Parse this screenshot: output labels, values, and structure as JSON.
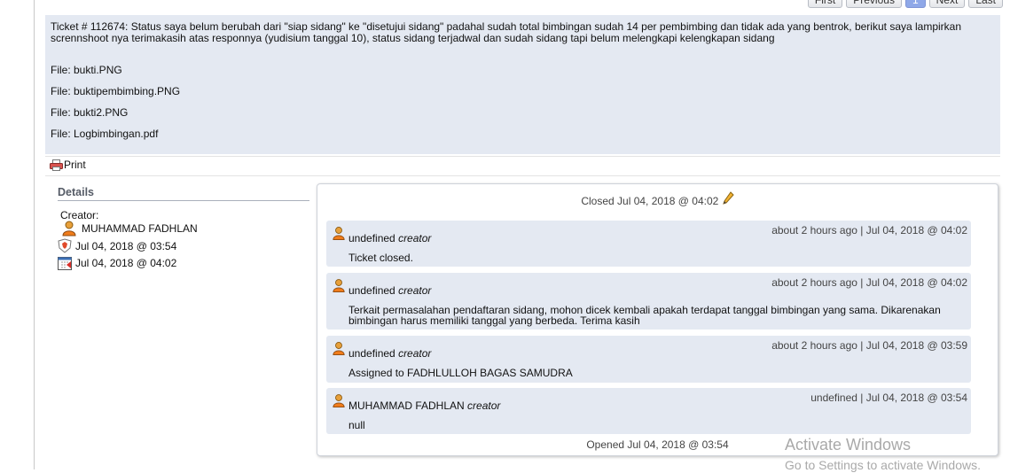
{
  "pagination": {
    "first": "First",
    "previous": "Previous",
    "current": "1",
    "next": "Next",
    "last": "Last"
  },
  "ticket": {
    "description": "Ticket # 112674: Status saya belum berubah dari \"siap sidang\" ke \"disetujui sidang\" padahal sudah total bimbingan sudah 14 per pembimbing dan tidak ada yang bentrok, berikut saya lampirkan scrennshoot nya terimakasih atas responnya (yudisium tanggal 10), status sidang terjadwal dan sudah sidang tapi belum melengkapi kelengkapan sidang",
    "files": [
      "File: bukti.PNG",
      "File: buktipembimbing.PNG",
      "File: bukti2.PNG",
      "File: Logbimbingan.pdf"
    ]
  },
  "print_label": "Print",
  "details": {
    "heading": "Details",
    "creator_label": "Creator:",
    "creator_name": "MUHAMMAD FADHLAN",
    "created_at": "Jul 04, 2018 @ 03:54",
    "closed_at": "Jul 04, 2018 @ 04:02"
  },
  "timeline": {
    "closed_text": "Closed Jul 04, 2018 @ 04:02",
    "opened_text": "Opened Jul 04, 2018 @ 03:54",
    "notes": [
      {
        "author": "undefined",
        "role": "creator",
        "when": "about 2 hours ago | Jul 04, 2018 @ 04:02",
        "text": "Ticket closed."
      },
      {
        "author": "undefined",
        "role": "creator",
        "when": "about 2 hours ago | Jul 04, 2018 @ 04:02",
        "text": "Terkait permasalahan pendaftaran sidang, mohon dicek kembali apakah terdapat tanggal bimbingan yang sama. Dikarenakan bimbingan harus memiliki tanggal yang berbeda. Terima kasih"
      },
      {
        "author": "undefined",
        "role": "creator",
        "when": "about 2 hours ago | Jul 04, 2018 @ 03:59",
        "text": "Assigned to FADHLULLOH BAGAS SAMUDRA"
      },
      {
        "author": "MUHAMMAD FADHLAN",
        "role": "creator",
        "when": "undefined | Jul 04, 2018 @ 03:54",
        "text": "null"
      }
    ]
  },
  "watermark": {
    "line1": "Activate Windows",
    "line2": "Go to Settings to activate Windows."
  },
  "icons": {
    "print": "printer-icon",
    "edit": "pencil-icon",
    "user": "user-avatar-icon",
    "created": "shield-badge-icon",
    "closed": "calendar-icon"
  }
}
